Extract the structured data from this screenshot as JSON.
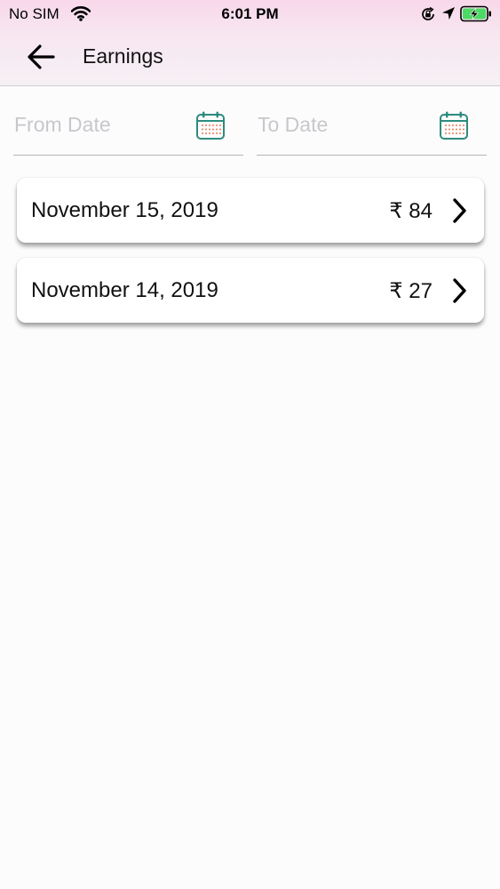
{
  "status_bar": {
    "carrier": "No SIM",
    "time": "6:01 PM",
    "icons": [
      "wifi-icon",
      "lock-rotation-icon",
      "location-icon",
      "battery-icon"
    ]
  },
  "nav": {
    "title": "Earnings",
    "back_icon": "arrow-left-icon"
  },
  "filters": {
    "from_placeholder": "From Date",
    "to_placeholder": "To Date",
    "icon": "calendar-icon"
  },
  "earnings": [
    {
      "date": "November 15, 2019",
      "amount": "₹ 84"
    },
    {
      "date": "November 14, 2019",
      "amount": "₹ 27"
    }
  ],
  "colors": {
    "header_gradient_top": "#f8d8ea",
    "calendar_accent": "#2e8b7e",
    "battery_green": "#4cd964"
  }
}
